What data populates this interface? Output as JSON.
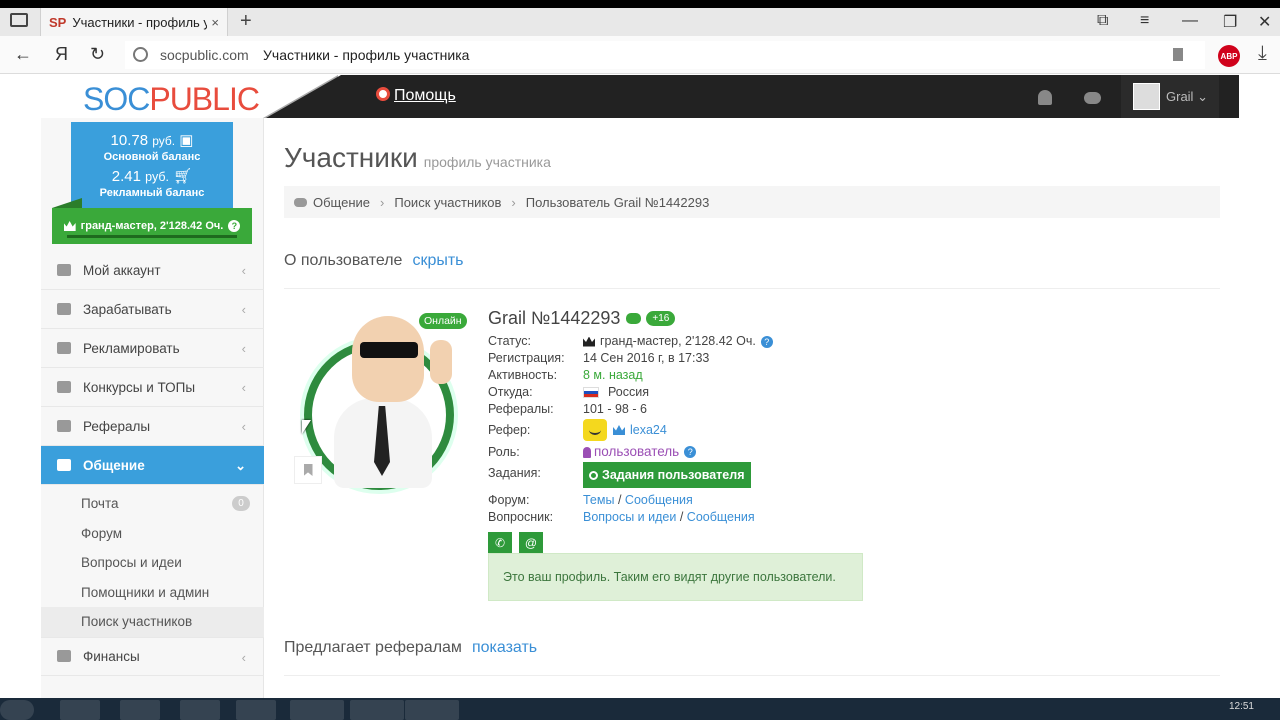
{
  "browser": {
    "tab_favicon": "SP",
    "tab_title": "Участники - профиль уч",
    "tab_close": "×",
    "new_tab": "+",
    "domain": "socpublic.com",
    "page_title": "Участники - профиль участника",
    "abp_label": "ABP",
    "yandex_label": "Я"
  },
  "header": {
    "logo_soc": "SOC",
    "logo_pub": "PUBLIC",
    "help_label": "Помощь",
    "username": "Grail"
  },
  "sidebar": {
    "balance_main": "10.78",
    "balance_main_currency": "руб.",
    "balance_main_label": "Основной баланс",
    "balance_ad": "2.41",
    "balance_ad_currency": "руб.",
    "balance_ad_label": "Рекламный баланс",
    "rank": "гранд-мастер, 2'128.42 Оч.",
    "items": [
      {
        "label": "Мой аккаунт"
      },
      {
        "label": "Зарабатывать"
      },
      {
        "label": "Рекламировать"
      },
      {
        "label": "Конкурсы и ТОПы"
      },
      {
        "label": "Рефералы"
      },
      {
        "label": "Общение"
      },
      {
        "label": "Финансы"
      }
    ],
    "subitems": [
      {
        "label": "Почта",
        "badge": "0"
      },
      {
        "label": "Форум"
      },
      {
        "label": "Вопросы и идеи"
      },
      {
        "label": "Помощники и админ"
      },
      {
        "label": "Поиск участников"
      }
    ]
  },
  "main": {
    "title": "Участники",
    "subtitle": "профиль участника",
    "breadcrumb": [
      "Общение",
      "Поиск участников",
      "Пользователь Grail №1442293"
    ],
    "about_title": "О пользователе",
    "about_toggle": "скрыть",
    "online": "Онлайн",
    "profile": {
      "name": "Grail №1442293",
      "plus": "+16",
      "status_key": "Статус:",
      "status_val": "гранд-мастер, 2'128.42 Оч.",
      "reg_key": "Регистрация:",
      "reg_val": "14 Сен 2016 г, в 17:33",
      "activity_key": "Активность:",
      "activity_val": "8 м. назад",
      "from_key": "Откуда:",
      "from_val": "Россия",
      "refs_key": "Рефералы:",
      "refs_val": "101 - 98 - 6",
      "referer_key": "Рефер:",
      "referer_val": "lexa24",
      "role_key": "Роль:",
      "role_val": "пользователь",
      "tasks_key": "Задания:",
      "tasks_btn": "Задания пользователя",
      "forum_key": "Форум:",
      "forum_themes": "Темы",
      "forum_msgs": "Сообщения",
      "qa_key": "Вопросник:",
      "qa_ideas": "Вопросы и идеи",
      "qa_msgs": "Сообщения",
      "slash": "/"
    },
    "notice": "Это ваш профиль. Таким его видят другие пользователи.",
    "offers_title": "Предлагает рефералам",
    "offers_toggle": "показать"
  },
  "taskbar": {
    "clock": "12:51"
  }
}
